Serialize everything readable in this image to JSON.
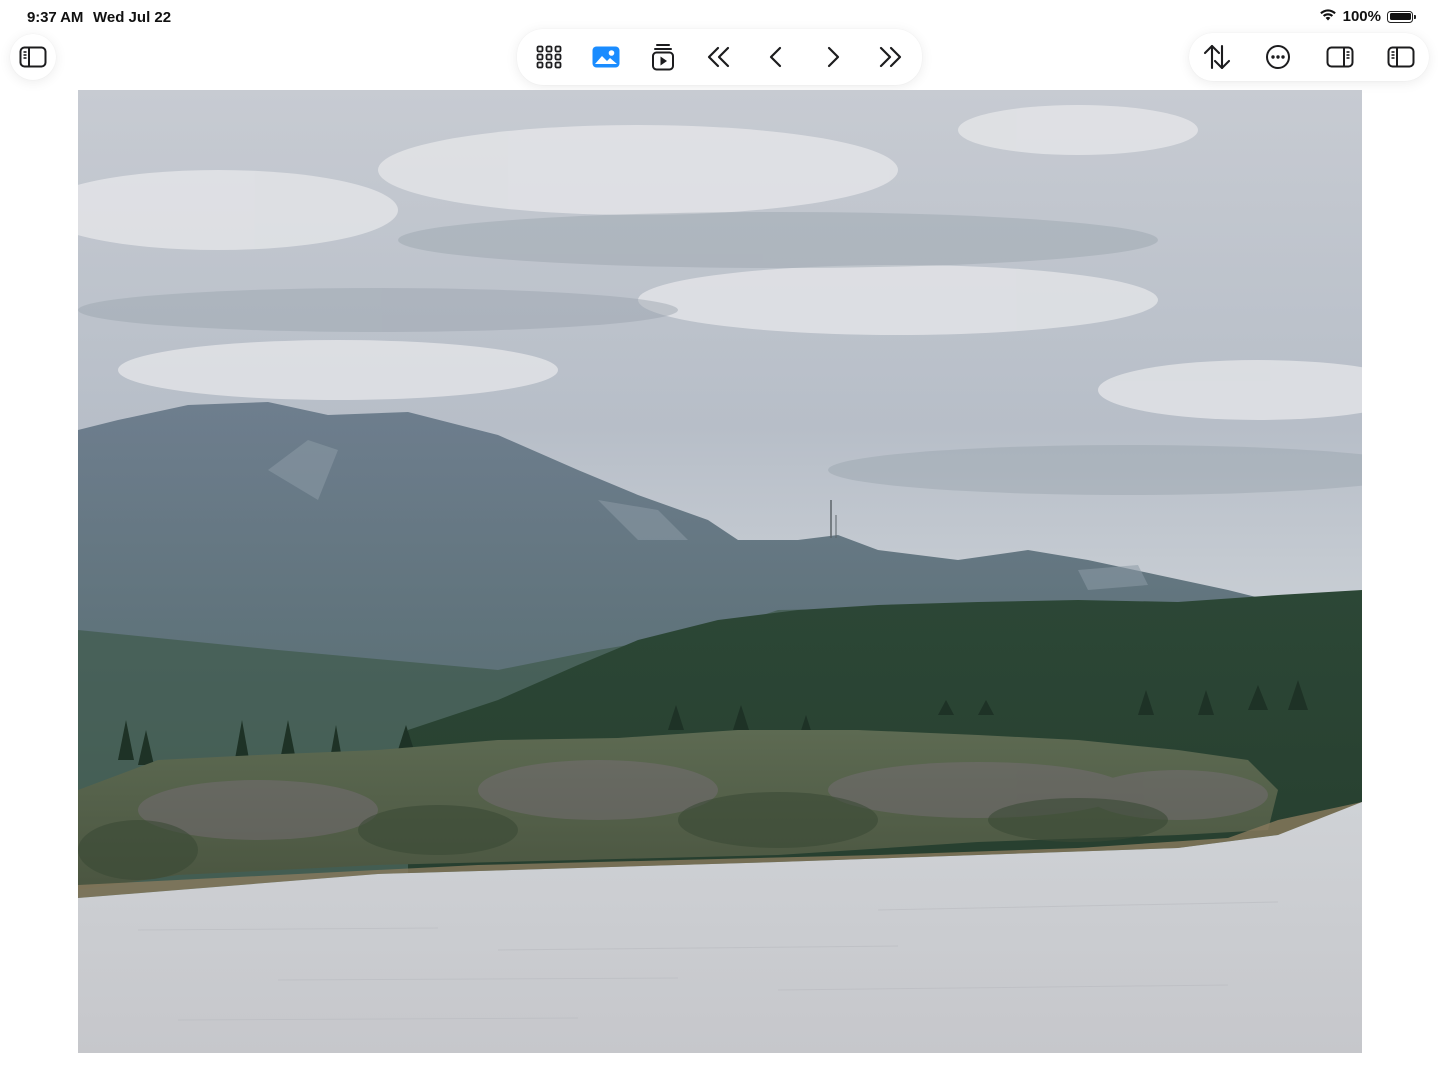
{
  "status_bar": {
    "time": "9:37 AM",
    "date": "Wed Jul 22",
    "battery_percent": "100%",
    "battery_level": 1.0,
    "wifi_icon": "wifi-icon"
  },
  "toolbar": {
    "left": [
      {
        "icon": "sidebar-left-icon"
      }
    ],
    "center": [
      {
        "icon": "grid-icon"
      },
      {
        "icon": "photo-icon",
        "active": true
      },
      {
        "icon": "slideshow-icon"
      },
      {
        "icon": "first-page-icon"
      },
      {
        "icon": "previous-page-icon"
      },
      {
        "icon": "next-page-icon"
      },
      {
        "icon": "last-page-icon"
      }
    ],
    "right": [
      {
        "icon": "sort-icon"
      },
      {
        "icon": "more-icon"
      },
      {
        "icon": "sidebar-right-icon"
      },
      {
        "icon": "sidebar-left-icon"
      }
    ]
  },
  "colors": {
    "accent": "#1a8cff",
    "icon": "#1c1c1e",
    "background": "#ffffff"
  },
  "photo": {
    "subject": "mountain-river-landscape"
  }
}
